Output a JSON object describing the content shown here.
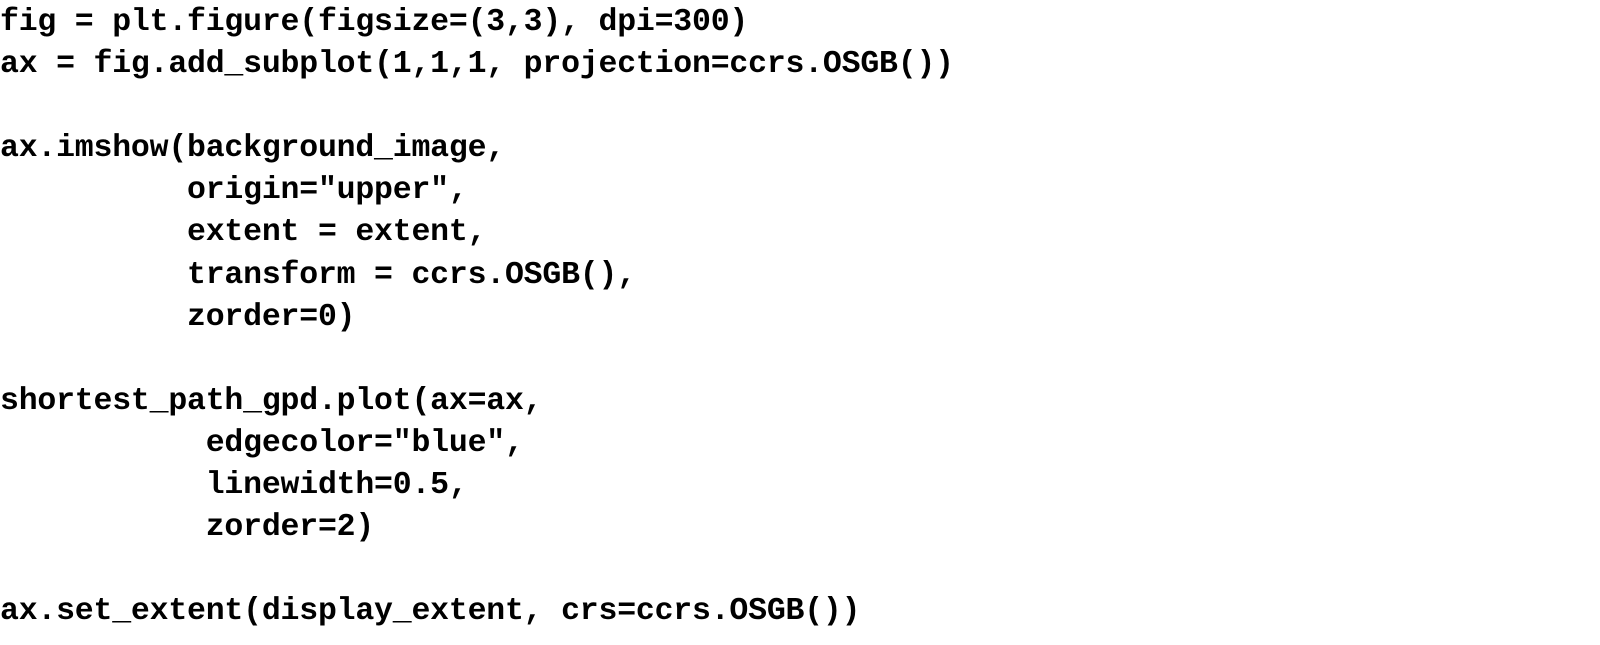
{
  "code": {
    "lines": [
      "fig = plt.figure(figsize=(3,3), dpi=300)",
      "ax = fig.add_subplot(1,1,1, projection=ccrs.OSGB())",
      "",
      "ax.imshow(background_image,",
      "          origin=\"upper\",",
      "          extent = extent,",
      "          transform = ccrs.OSGB(),",
      "          zorder=0)",
      "",
      "shortest_path_gpd.plot(ax=ax,",
      "           edgecolor=\"blue\",",
      "           linewidth=0.5,",
      "           zorder=2)",
      "",
      "ax.set_extent(display_extent, crs=ccrs.OSGB())"
    ]
  }
}
